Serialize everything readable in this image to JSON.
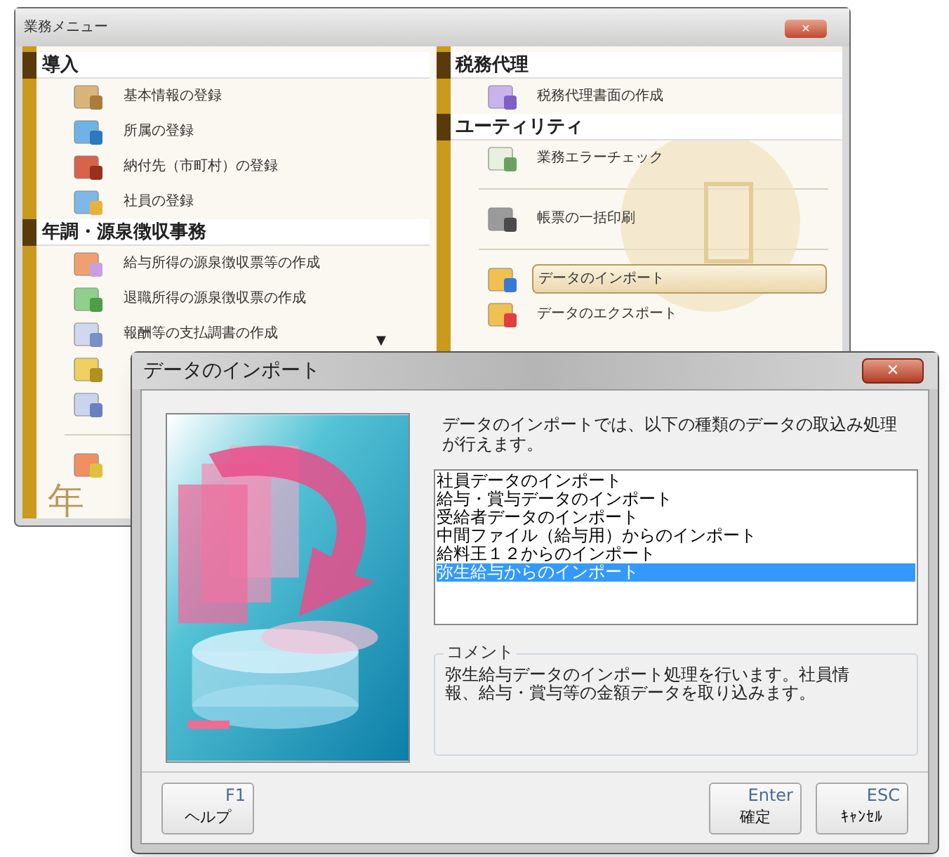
{
  "menu_window": {
    "title": "業務メニュー",
    "background_mark": "年",
    "columns": [
      {
        "sections": [
          {
            "title": "導入",
            "items": [
              {
                "kind": "item",
                "label": "基本情報の登録",
                "selected": false
              },
              {
                "kind": "item",
                "label": "所属の登録",
                "selected": false
              },
              {
                "kind": "item",
                "label": "納付先（市町村）の登録",
                "selected": false
              },
              {
                "kind": "item",
                "label": "社員の登録",
                "selected": false
              }
            ]
          },
          {
            "title": "年調・源泉徴収事務",
            "items": [
              {
                "kind": "item",
                "label": "給与所得の源泉徴収票等の作成",
                "selected": false
              },
              {
                "kind": "item",
                "label": "退職所得の源泉徴収票の作成",
                "selected": false
              },
              {
                "kind": "item",
                "label": "報酬等の支払調書の作成",
                "selected": false
              },
              {
                "kind": "item"
              },
              {
                "kind": "item"
              },
              {
                "kind": "divider"
              },
              {
                "kind": "item"
              }
            ]
          }
        ],
        "scroll_arrow": "▼"
      },
      {
        "sections": [
          {
            "title": "税務代理",
            "items": [
              {
                "kind": "item",
                "label": "税務代理書面の作成",
                "selected": false
              }
            ]
          },
          {
            "title": "ユーティリティ",
            "items": [
              {
                "kind": "item",
                "label": "業務エラーチェック",
                "selected": false
              },
              {
                "kind": "divider"
              },
              {
                "kind": "item",
                "label": "帳票の一括印刷",
                "selected": false
              },
              {
                "kind": "divider"
              },
              {
                "kind": "item",
                "label": "データのインポート",
                "selected": true
              },
              {
                "kind": "item",
                "label": "データのエクスポート",
                "selected": false
              }
            ]
          }
        ]
      }
    ]
  },
  "dialog": {
    "title": "データのインポート",
    "close": "✕",
    "description": "データのインポートでは、以下の種類のデータの取込み処理が行えます。",
    "list": [
      {
        "label": "社員データのインポート",
        "selected": false
      },
      {
        "label": "給与・賞与データのインポート",
        "selected": false
      },
      {
        "label": "受給者データのインポート",
        "selected": false
      },
      {
        "label": "中間ファイル（給与用）からのインポート",
        "selected": false
      },
      {
        "label": "給料王１２からのインポート",
        "selected": false
      },
      {
        "label": "弥生給与からのインポート",
        "selected": true
      }
    ],
    "comment": {
      "legend": "コメント",
      "text": "弥生給与データのインポート処理を行います。社員情報、給与・賞与等の金額データを取り込みます。"
    },
    "buttons": [
      {
        "key": "F1",
        "label": "ヘルプ"
      },
      {
        "key": "Enter",
        "label": "確定"
      },
      {
        "key": "ESC",
        "label": "ｷｬﾝｾﾙ"
      }
    ]
  }
}
